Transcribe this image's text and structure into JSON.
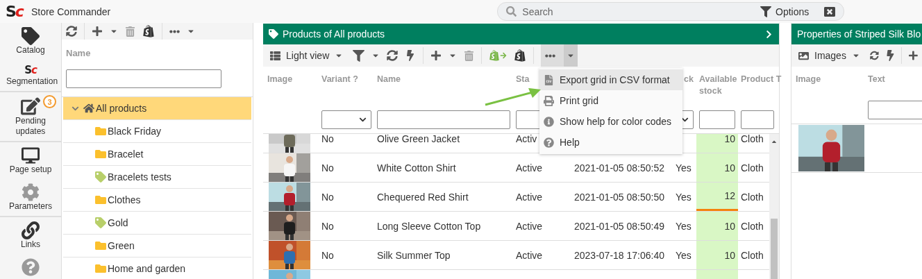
{
  "app": {
    "logo": "Sc",
    "title": "Store Commander"
  },
  "search": {
    "placeholder": "Search",
    "options_label": "Options"
  },
  "nav": [
    {
      "kind": "catalog",
      "label": "Catalog"
    },
    {
      "kind": "segmentation",
      "logo": "Sc",
      "label": "Segmentation"
    },
    {
      "kind": "pending",
      "label": "Pending updates",
      "badge": "3"
    },
    {
      "kind": "page_setup",
      "label": "Page setup"
    },
    {
      "kind": "parameters",
      "label": "Parameters"
    },
    {
      "kind": "links",
      "label": "Links"
    },
    {
      "kind": "help"
    }
  ],
  "tree": {
    "column": "Name",
    "items": [
      {
        "label": "All products",
        "kind": "home",
        "selected": true,
        "expanded": true,
        "children": [
          {
            "label": "Black Friday",
            "kind": "folder",
            "selected": false
          },
          {
            "label": "Bracelet",
            "kind": "folder",
            "selected": false
          },
          {
            "label": "Bracelets tests",
            "kind": "tag",
            "selected": false
          },
          {
            "label": "Clothes",
            "kind": "folder",
            "selected": false
          },
          {
            "label": "Gold",
            "kind": "tag",
            "selected": false
          },
          {
            "label": "Green",
            "kind": "folder",
            "selected": false
          },
          {
            "label": "Home and garden",
            "kind": "folder",
            "selected": false
          }
        ]
      }
    ]
  },
  "products": {
    "title": "Products of All products",
    "view_label": "Light view",
    "more_expanded": true,
    "columns": [
      {
        "label": "Image",
        "kind": "none"
      },
      {
        "label": "Variant ?",
        "kind": "select"
      },
      {
        "label": "Name",
        "kind": "text"
      },
      {
        "label": "Sta",
        "kind": "select"
      },
      {
        "kind": "none"
      },
      {
        "label": "ck",
        "kind": "select"
      },
      {
        "label": "Available stock",
        "kind": "text"
      },
      {
        "label": "Product T",
        "kind": "text"
      }
    ],
    "rows": [
      {
        "variant": "No",
        "name": "Olive Green Jacket",
        "status": "Activ",
        "available": "10",
        "type": "Cloth",
        "flagged": false
      },
      {
        "variant": "No",
        "name": "White Cotton Shirt",
        "status": "Active",
        "date": "2021-01-05 08:50:52",
        "stock": "Yes",
        "available": "10",
        "type": "Cloth",
        "flagged": false
      },
      {
        "variant": "No",
        "name": "Chequered Red Shirt",
        "status": "Active",
        "date": "2021-01-05 08:50:50",
        "stock": "Yes",
        "available": "12",
        "type": "Cloth",
        "flagged": true
      },
      {
        "variant": "No",
        "name": "Long Sleeve Cotton Top",
        "status": "Active",
        "date": "2021-01-05 08:50:49",
        "stock": "Yes",
        "available": "10",
        "type": "Cloth",
        "flagged": false
      },
      {
        "variant": "No",
        "name": "Silk Summer Top",
        "status": "Active",
        "date": "2023-07-18 17:06:40",
        "stock": "Yes",
        "available": "10",
        "type": "Cloth",
        "flagged": false
      }
    ],
    "menu": [
      {
        "kind": "csv",
        "label": "Export grid in CSV format",
        "selected": true
      },
      {
        "kind": "print",
        "label": "Print grid",
        "selected": false
      },
      {
        "kind": "info",
        "label": "Show help for color codes",
        "selected": false
      },
      {
        "kind": "help",
        "label": "Help",
        "selected": false
      }
    ]
  },
  "properties": {
    "title": "Properties of Striped Silk Blo",
    "view_label": "Images",
    "columns": [
      "Image",
      "Text"
    ]
  }
}
